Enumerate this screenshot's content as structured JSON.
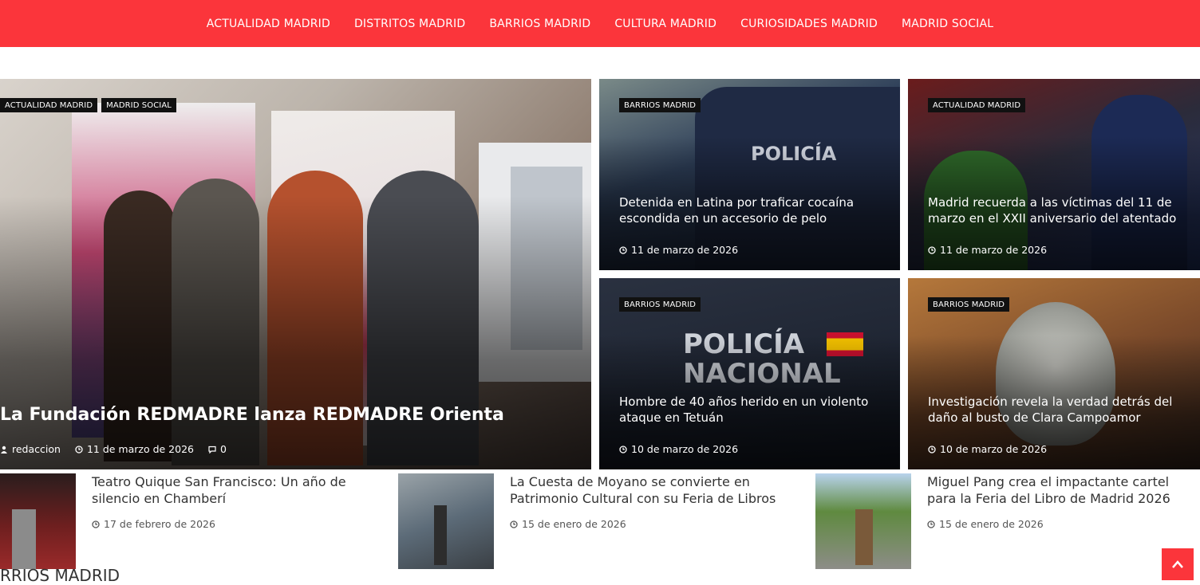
{
  "nav": {
    "items": [
      "ACTUALIDAD MADRID",
      "DISTRITOS MADRID",
      "BARRIOS MADRID",
      "CULTURA MADRID",
      "CURIOSIDADES MADRID",
      "MADRID SOCIAL"
    ]
  },
  "main_post": {
    "categories": [
      "ACTUALIDAD MADRID",
      "MADRID SOCIAL"
    ],
    "title": "La Fundación REDMADRE lanza REDMADRE Orienta",
    "author": "redaccion",
    "date": "11 de marzo de 2026",
    "comments": "0"
  },
  "grid_posts": [
    {
      "category": "BARRIOS MADRID",
      "title": "Detenida en Latina por traficar cocaína escondida en un accesorio de pelo",
      "date": "11 de marzo de 2026"
    },
    {
      "category": "ACTUALIDAD MADRID",
      "title": "Madrid recuerda a las víctimas del 11 de marzo en el XXII aniversario del atentado",
      "date": "11 de marzo de 2026"
    },
    {
      "category": "BARRIOS MADRID",
      "title": "Hombre de 40 años herido en un violento ataque en Tetuán",
      "date": "10 de marzo de 2026"
    },
    {
      "category": "BARRIOS MADRID",
      "title": "Investigación revela la verdad detrás del daño al busto de Clara Campoamor",
      "date": "10 de marzo de 2026"
    }
  ],
  "small_posts": [
    {
      "title": "Teatro Quique San Francisco: Un año de silencio en Chamberí",
      "date": "17 de febrero de 2026"
    },
    {
      "title": "La Cuesta de Moyano se convierte en Patrimonio Cultural con su Feria de Libros",
      "date": "15 de enero de 2026"
    },
    {
      "title": "Miguel Pang crea el impactante cartel para la Feria del Libro de Madrid 2026",
      "date": "15 de enero de 2026"
    }
  ],
  "section": {
    "label": "RRIOS MADRID"
  },
  "colors": {
    "accent": "#fb353b",
    "badge": "#111111"
  },
  "icons": {
    "author": "user-icon",
    "date": "clock-icon",
    "comments": "comment-icon",
    "scroll": "chevron-up-icon"
  }
}
